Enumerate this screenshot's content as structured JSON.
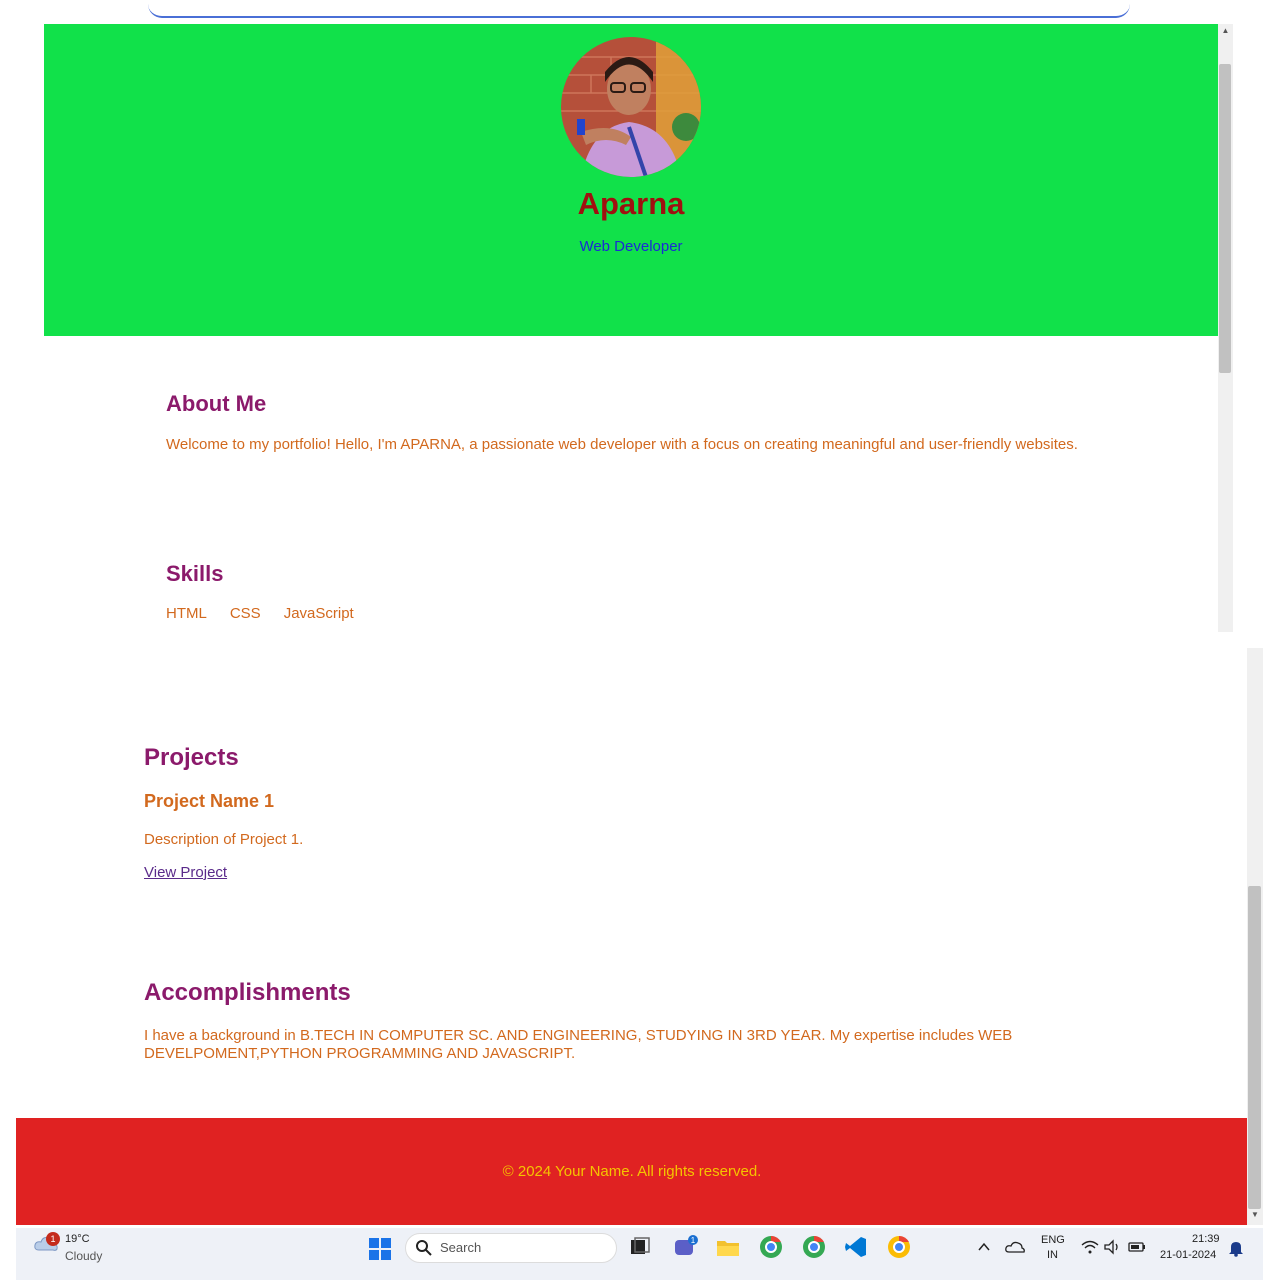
{
  "profile": {
    "name": "Aparna",
    "role": "Web Developer"
  },
  "about": {
    "title": "About Me",
    "text": "Welcome to my portfolio! Hello, I'm APARNA, a passionate web developer with a focus on creating meaningful and user-friendly websites."
  },
  "skills": {
    "title": "Skills",
    "items": [
      "HTML",
      "CSS",
      "JavaScript"
    ]
  },
  "projects": {
    "title": "Projects",
    "items": [
      {
        "name": "Project Name 1",
        "description": "Description of Project 1.",
        "link": "View Project"
      }
    ]
  },
  "accomplishments": {
    "title": "Accomplishments",
    "text": "I have a background in B.TECH IN COMPUTER SC. AND ENGINEERING, STUDYING IN 3RD YEAR. My expertise includes WEB DEVELPOMENT,PYTHON PROGRAMMING AND JAVASCRIPT."
  },
  "footer": {
    "text": "© 2024 Your Name. All rights reserved."
  },
  "colors": {
    "header_bg": "#11e14a",
    "name": "#a01010",
    "role": "#1a2ad6",
    "section_title": "#8b1a6b",
    "body_text": "#d2691e",
    "footer_bg": "#e02222",
    "footer_text": "#f5c400"
  },
  "taskbar": {
    "weather": {
      "temp": "19°C",
      "condition": "Cloudy",
      "badge": "1",
      "icon": "cloud-icon"
    },
    "search_label": "Search",
    "chat_badge": "1",
    "apps": [
      "file-explorer-icon",
      "chat-icon",
      "folder-icon",
      "chrome-icon",
      "chrome-icon",
      "vscode-icon",
      "chrome-icon"
    ],
    "language": {
      "line1": "ENG",
      "line2": "IN"
    },
    "clock": {
      "time": "21:39",
      "date": "21-01-2024"
    }
  }
}
